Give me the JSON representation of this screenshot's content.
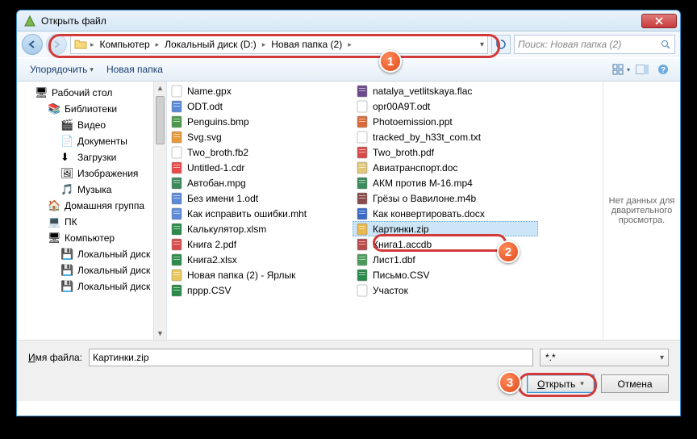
{
  "title": "Открыть файл",
  "breadcrumb": [
    "Компьютер",
    "Локальный диск (D:)",
    "Новая папка (2)"
  ],
  "search_placeholder": "Поиск: Новая папка (2)",
  "toolbar": {
    "organize": "Упорядочить",
    "newfolder": "Новая папка"
  },
  "tree": [
    {
      "icon": "desktop",
      "label": "Рабочий стол",
      "lvl": 1
    },
    {
      "icon": "lib",
      "label": "Библиотеки",
      "lvl": 2
    },
    {
      "icon": "video",
      "label": "Видео",
      "lvl": 3
    },
    {
      "icon": "doc",
      "label": "Документы",
      "lvl": 3
    },
    {
      "icon": "down",
      "label": "Загрузки",
      "lvl": 3
    },
    {
      "icon": "pic",
      "label": "Изображения",
      "lvl": 3
    },
    {
      "icon": "music",
      "label": "Музыка",
      "lvl": 3
    },
    {
      "icon": "home",
      "label": "Домашняя группа",
      "lvl": 2
    },
    {
      "icon": "pc",
      "label": "ПК",
      "lvl": 2
    },
    {
      "icon": "computer",
      "label": "Компьютер",
      "lvl": 2
    },
    {
      "icon": "drive",
      "label": "Локальный диск",
      "lvl": 3
    },
    {
      "icon": "drive",
      "label": "Локальный диск",
      "lvl": 3
    },
    {
      "icon": "drive",
      "label": "Локальный диск",
      "lvl": 3
    }
  ],
  "files_col1": [
    {
      "icon": "gpx",
      "name": "Name.gpx"
    },
    {
      "icon": "odt",
      "name": "ODT.odt"
    },
    {
      "icon": "bmp",
      "name": "Penguins.bmp"
    },
    {
      "icon": "svg",
      "name": "Svg.svg"
    },
    {
      "icon": "fb2",
      "name": "Two_broth.fb2"
    },
    {
      "icon": "cdr",
      "name": "Untitled-1.cdr"
    },
    {
      "icon": "mpg",
      "name": "Автобан.mpg"
    },
    {
      "icon": "odt",
      "name": "Без имени 1.odt"
    },
    {
      "icon": "mht",
      "name": "Как исправить ошибки.mht"
    },
    {
      "icon": "xlsm",
      "name": "Калькулятор.xlsm"
    },
    {
      "icon": "pdf",
      "name": "Книга 2.pdf"
    },
    {
      "icon": "xlsx",
      "name": "Книга2.xlsx"
    },
    {
      "icon": "lnk",
      "name": "Новая папка (2) - Ярлык"
    },
    {
      "icon": "csv",
      "name": "пррр.CSV"
    }
  ],
  "files_col2": [
    {
      "icon": "flac",
      "name": "natalya_vetlitskaya.flac"
    },
    {
      "icon": "txt",
      "name": "opr00A9T.odt"
    },
    {
      "icon": "ppt",
      "name": "Photoemission.ppt"
    },
    {
      "icon": "txt",
      "name": "tracked_by_h33t_com.txt"
    },
    {
      "icon": "pdf",
      "name": "Two_broth.pdf"
    },
    {
      "icon": "doc",
      "name": "Авиатранспорт.doc"
    },
    {
      "icon": "mp4",
      "name": "АКМ против М-16.mp4"
    },
    {
      "icon": "m4b",
      "name": "Грёзы о Вавилоне.m4b"
    },
    {
      "icon": "docx",
      "name": "Как конвертировать.docx"
    },
    {
      "icon": "zip",
      "name": "Картинки.zip",
      "selected": true
    },
    {
      "icon": "accdb",
      "name": "Книга1.accdb"
    },
    {
      "icon": "dbf",
      "name": "Лист1.dbf"
    },
    {
      "icon": "csv",
      "name": "Письмо.CSV"
    },
    {
      "icon": "gen",
      "name": "Участок"
    }
  ],
  "preview_text": "Нет данных для дварительного просмотра.",
  "filename_label": "Имя файла:",
  "filename_value": "Картинки.zip",
  "filter_value": "*.*",
  "open_label": "Открыть",
  "cancel_label": "Отмена",
  "badges": [
    "1",
    "2",
    "3"
  ]
}
